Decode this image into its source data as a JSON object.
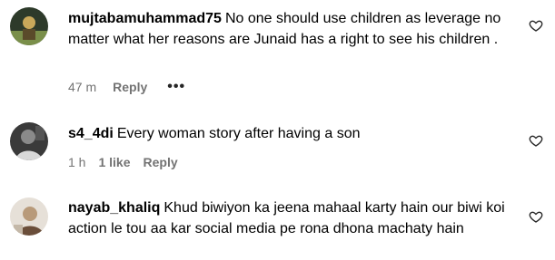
{
  "comments": [
    {
      "username": "mujtabamuhammad75",
      "text": "No one should use children as leverage no matter what her reasons are Junaid has a right to see his children .",
      "time": "47 m",
      "likes": "",
      "reply_label": "Reply",
      "more_label": "•••",
      "avatar_colors": [
        "#2d3a2a",
        "#7a8f4a",
        "#c9a85a"
      ]
    },
    {
      "username": "s4_4di",
      "text": "Every woman story after having a son",
      "time": "1 h",
      "likes": "1 like",
      "reply_label": "Reply",
      "avatar_colors": [
        "#3a3a3a",
        "#8a8a8a",
        "#d8d8d8"
      ]
    },
    {
      "username": "nayab_khaliq",
      "text": "Khud biwiyon ka jeena mahaal karty hain our biwi koi action le tou aa kar social media pe rona dhona machaty hain",
      "time": "",
      "likes": "",
      "reply_label": "",
      "avatar_colors": [
        "#e6e0d8",
        "#b89a7a",
        "#6a4e3a"
      ]
    }
  ]
}
